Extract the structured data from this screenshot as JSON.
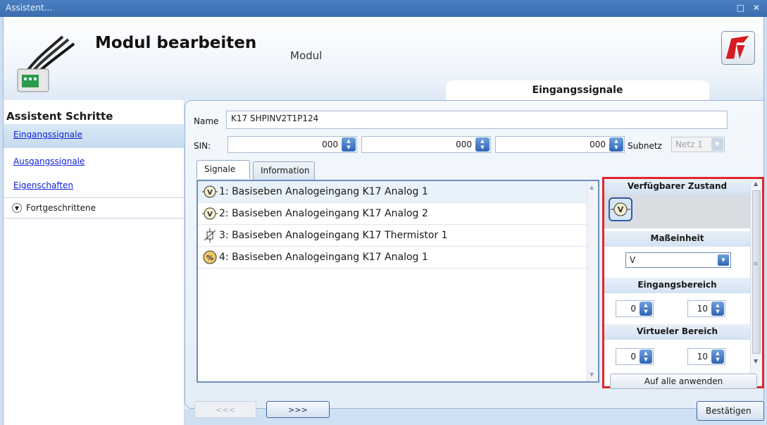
{
  "window": {
    "title": "Assistent...",
    "buttons": "□ ✕"
  },
  "header": {
    "title": "Modul bearbeiten",
    "subtitle": "Modul",
    "current_step": "Eingangssignale"
  },
  "sidebar": {
    "heading": "Assistent Schritte",
    "steps": [
      {
        "label": "Eingangssignale",
        "active": true
      },
      {
        "label": "Ausgangssignale",
        "active": false
      },
      {
        "label": "Eigenschaften",
        "active": false
      }
    ],
    "advanced_label": "Fortgeschrittene"
  },
  "form": {
    "name_label": "Name",
    "name_value": "K17 SHPINV2T1P124",
    "sin_label": "SIN:",
    "sin_values": [
      "000",
      "000",
      "000"
    ],
    "subnet_label": "Subnetz",
    "subnet_value": "Netz 1"
  },
  "tabs": [
    {
      "label": "Signale",
      "active": true
    },
    {
      "label": "Information",
      "active": false
    }
  ],
  "signals": [
    {
      "label": "1: Basiseben Analogeingang K17 Analog 1",
      "icon": "voltage-icon",
      "selected": true
    },
    {
      "label": "2: Basiseben Analogeingang K17 Analog 2",
      "icon": "voltage-icon",
      "selected": false
    },
    {
      "label": "3: Basiseben Analogeingang K17 Thermistor 1",
      "icon": "thermistor-icon",
      "selected": false
    },
    {
      "label": "4: Basiseben Analogeingang K17 Analog 1",
      "icon": "percent-icon",
      "selected": false
    }
  ],
  "settings": {
    "available_state_label": "Verfügbarer Zustand",
    "unit_label": "Maßeinheit",
    "unit_value": "V",
    "input_range_label": "Eingangsbereich",
    "input_range": [
      "0",
      "10"
    ],
    "virtual_range_label": "Virtueler Bereich",
    "virtual_range": [
      "0",
      "10"
    ],
    "apply_all_label": "Auf alle anwenden"
  },
  "nav": {
    "back_label": "<<<",
    "next_label": ">>>",
    "confirm_label": "Bestätigen"
  },
  "colors": {
    "highlight_border": "#e0262b",
    "title_bar": "#3a6db0",
    "link": "#0d1fd6"
  }
}
